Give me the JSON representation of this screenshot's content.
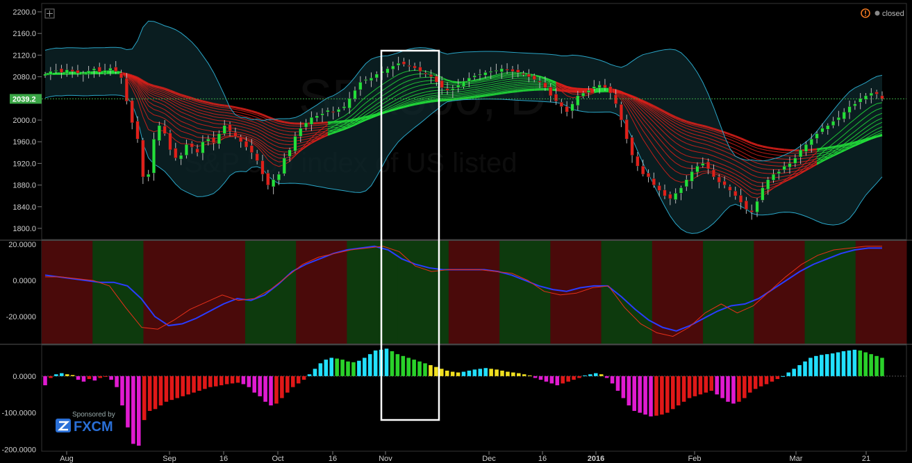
{
  "window": {
    "watermark_symbol": "SPX500, D",
    "watermark_desc": "S&P 500 index of US listed",
    "status_label": "closed",
    "sponsor_label": "Sponsored by",
    "sponsor_brand": "FXCM",
    "colors": {
      "background": "#000000",
      "ribbon_red": "#e0201a",
      "ribbon_green": "#22e03a",
      "bollinger": "#2aa6c8",
      "zone_red": "#4a0a0a",
      "zone_green": "#0d3a0d",
      "highlight_box": "#ffffff",
      "price_tag": "#3aa646",
      "status_icon": "#f07820"
    },
    "icons": [
      "crosshair-icon",
      "warning-icon",
      "status-dot-icon",
      "fxcm-logo-icon"
    ]
  },
  "chart_data": [
    {
      "type": "candlestick",
      "title": "",
      "ylim": [
        1780,
        2210
      ],
      "y_ticks": [
        "2200.0",
        "2160.0",
        "2120.0",
        "2080.0",
        "2040.0",
        "2000.0",
        "1960.0",
        "1920.0",
        "1880.0",
        "1840.0",
        "1800.0"
      ],
      "last_price_label": "2039.2",
      "x_ticks": [
        "Aug",
        "Sep",
        "16",
        "Oct",
        "16",
        "Nov",
        "Dec",
        "16",
        "2016",
        "Feb",
        "Mar",
        "21"
      ],
      "x_ticks_bold": [
        "2016"
      ],
      "close_series": [
        2085,
        2090,
        2092,
        2088,
        2093,
        2090,
        2087,
        2086,
        2091,
        2095,
        2089,
        2092,
        2096,
        2090,
        2078,
        2035,
        1995,
        1965,
        1895,
        1900,
        1965,
        1990,
        1975,
        1945,
        1930,
        1935,
        1955,
        1950,
        1940,
        1960,
        1965,
        1958,
        1975,
        1990,
        1980,
        1970,
        1960,
        1950,
        1940,
        1925,
        1900,
        1880,
        1890,
        1900,
        1930,
        1945,
        1970,
        1985,
        1995,
        2005,
        2008,
        2012,
        2018,
        2015,
        2020,
        2025,
        2040,
        2055,
        2070,
        2075,
        2078,
        2085,
        2090,
        2095,
        2100,
        2105,
        2103,
        2100,
        2096,
        2090,
        2085,
        2080,
        2070,
        2060,
        2055,
        2058,
        2065,
        2072,
        2078,
        2082,
        2085,
        2088,
        2090,
        2092,
        2095,
        2093,
        2090,
        2088,
        2085,
        2080,
        2075,
        2070,
        2060,
        2045,
        2035,
        2025,
        2015,
        2030,
        2045,
        2050,
        2055,
        2062,
        2065,
        2060,
        2050,
        2030,
        2000,
        1965,
        1935,
        1915,
        1900,
        1895,
        1880,
        1870,
        1860,
        1855,
        1865,
        1875,
        1890,
        1905,
        1915,
        1920,
        1910,
        1895,
        1885,
        1880,
        1870,
        1860,
        1848,
        1835,
        1830,
        1850,
        1875,
        1890,
        1900,
        1905,
        1915,
        1920,
        1930,
        1945,
        1955,
        1965,
        1975,
        1985,
        1990,
        1998,
        2005,
        2015,
        2025,
        2030,
        2040,
        2045,
        2050,
        2048,
        2039
      ],
      "bollinger_upper_start": 2140,
      "ribbon": {
        "red_top": 2080,
        "green_bottom": 2045
      }
    },
    {
      "type": "line",
      "title": "",
      "ylim": [
        -35,
        22
      ],
      "y_ticks": [
        "20.0000",
        "0.0000",
        "-20.0000"
      ],
      "series": [
        {
          "values": [
            3,
            2,
            1,
            0,
            -1,
            -1,
            -3,
            -10,
            -20,
            -25,
            -24,
            -21,
            -17,
            -13,
            -10,
            -11,
            -8,
            -2,
            5,
            9,
            12,
            15,
            17,
            18,
            19,
            17,
            12,
            9,
            7,
            6,
            6,
            6,
            6,
            5,
            3,
            0,
            -3,
            -5,
            -6,
            -4,
            -3,
            -3,
            -9,
            -16,
            -22,
            -26,
            -28,
            -25,
            -21,
            -17,
            -14,
            -13,
            -10,
            -5,
            0,
            5,
            9,
            12,
            15,
            17,
            18,
            18
          ]
        },
        {
          "values": [
            2,
            2,
            1,
            0,
            -3,
            -15,
            -26,
            -27,
            -22,
            -16,
            -12,
            -8,
            -11,
            -10,
            -5,
            2,
            9,
            13,
            15,
            17,
            18,
            19,
            16,
            8,
            5,
            6,
            6,
            6,
            5,
            4,
            0,
            -6,
            -8,
            -7,
            -4,
            -3,
            -15,
            -24,
            -29,
            -31,
            -26,
            -18,
            -13,
            -18,
            -14,
            -6,
            2,
            9,
            14,
            17,
            18,
            19,
            19
          ]
        }
      ],
      "zones": [
        "red",
        "green",
        "red",
        "red",
        "green",
        "red",
        "green",
        "green",
        "red",
        "green",
        "red",
        "green",
        "red",
        "green",
        "red",
        "green",
        "red"
      ]
    },
    {
      "type": "bar",
      "title": "",
      "ylim": [
        -205,
        85
      ],
      "y_ticks": [
        "0.0000",
        "-100.0000",
        "-200.0000"
      ],
      "values": [
        -25,
        -5,
        5,
        8,
        5,
        3,
        -10,
        -15,
        -8,
        -12,
        -5,
        -2,
        -10,
        -30,
        -80,
        -140,
        -185,
        -190,
        -120,
        -95,
        -90,
        -80,
        -70,
        -65,
        -60,
        -55,
        -50,
        -45,
        -40,
        -35,
        -30,
        -28,
        -25,
        -22,
        -20,
        -18,
        -22,
        -30,
        -45,
        -55,
        -70,
        -80,
        -75,
        -60,
        -45,
        -30,
        -20,
        -10,
        5,
        20,
        35,
        45,
        50,
        48,
        45,
        40,
        38,
        42,
        50,
        60,
        70,
        72,
        75,
        68,
        60,
        55,
        50,
        45,
        40,
        35,
        30,
        25,
        20,
        15,
        12,
        10,
        12,
        15,
        18,
        20,
        22,
        20,
        18,
        15,
        12,
        10,
        8,
        5,
        2,
        -5,
        -10,
        -15,
        -20,
        -25,
        -20,
        -15,
        -10,
        -5,
        2,
        5,
        8,
        5,
        -5,
        -20,
        -40,
        -60,
        -80,
        -95,
        -100,
        -105,
        -110,
        -108,
        -105,
        -100,
        -90,
        -80,
        -70,
        -60,
        -55,
        -50,
        -45,
        -40,
        -50,
        -60,
        -70,
        -75,
        -70,
        -60,
        -45,
        -35,
        -28,
        -22,
        -15,
        -8,
        0,
        10,
        20,
        30,
        40,
        50,
        55,
        58,
        60,
        62,
        65,
        68,
        70,
        72,
        70,
        65,
        60,
        55,
        50
      ]
    }
  ]
}
